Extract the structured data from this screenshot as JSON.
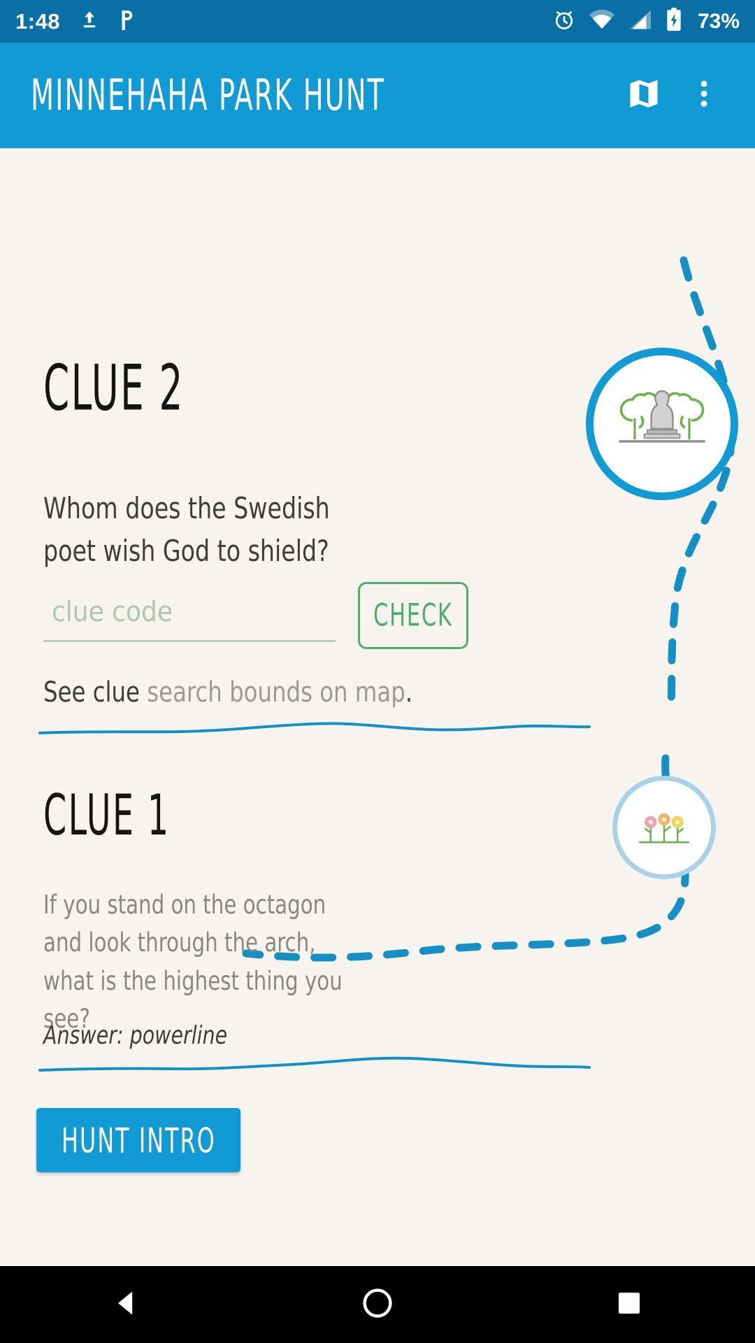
{
  "status_bar": {
    "time": "1:48",
    "battery_percent": "73%",
    "icons": [
      "upload-icon",
      "pocketcasts-icon",
      "alarm-icon",
      "wifi-icon",
      "cell-signal-icon",
      "battery-charging-icon"
    ],
    "background_color": "#0a6fa4"
  },
  "app_bar": {
    "title": "MINNEHAHA PARK HUNT",
    "map_button": "map-icon",
    "overflow_button": "more-vert-icon",
    "background_color": "#119ad4"
  },
  "clues": [
    {
      "title": "CLUE 2",
      "question": "Whom does the Swedish poet wish God to shield?",
      "input_placeholder": "clue code",
      "input_value": "",
      "check_label": "CHECK",
      "see_clue_prefix": "See clue ",
      "see_clue_link": "search bounds on map",
      "see_clue_suffix": ".",
      "badge_icon": "statue-with-trees-icon",
      "badge_ring_color": "#119ad4",
      "solved": false
    },
    {
      "title": "CLUE 1",
      "question": "If you stand on the octagon and look through the arch, what is the highest thing you see?",
      "answer_label": "Answer: powerline",
      "badge_icon": "flower-garden-icon",
      "badge_ring_color": "#a9d2e8",
      "solved": true
    }
  ],
  "hunt_intro_button": {
    "label": "HUNT INTRO",
    "background_color": "#119ad4"
  },
  "theme": {
    "page_background": "#f7f4ef",
    "accent_blue": "#119ad4",
    "trail_blue": "#1690c4",
    "check_green": "#4caf68",
    "placeholder_green": "#aec7ae",
    "muted_text": "#8a8781",
    "body_text": "#3d3d3b"
  },
  "nav_bar": {
    "back": "back-triangle-icon",
    "home": "home-circle-icon",
    "recents": "recents-square-icon",
    "background_color": "#000000"
  }
}
